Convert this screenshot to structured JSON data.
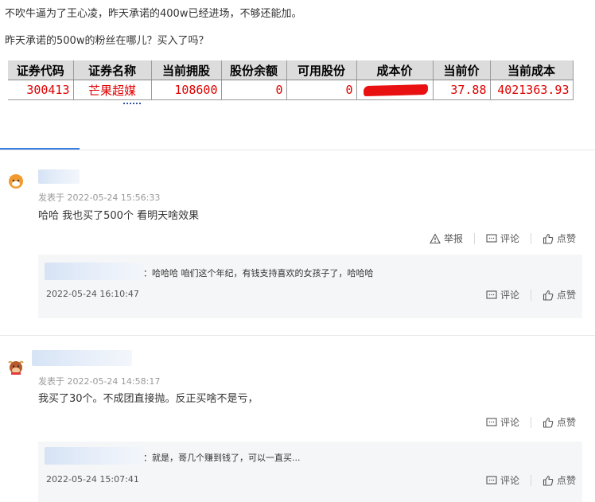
{
  "post": {
    "line1": "不吹牛逼为了王心凌，昨天承诺的400w已经进场，不够还能加。",
    "line2": "昨天承诺的500w的粉丝在哪儿？买入了吗？"
  },
  "stock_table": {
    "headers": [
      "证券代码",
      "证券名称",
      "当前拥股",
      "股份余额",
      "可用股份",
      "成本价",
      "当前价",
      "当前成本"
    ],
    "row": {
      "code": "300413",
      "name": "芒果超媒",
      "holding": "108600",
      "balance": "0",
      "available": "0",
      "current_price": "37.88",
      "current_cost": "4021363.93"
    }
  },
  "comments": [
    {
      "time": "发表于 2022-05-24 15:56:33",
      "text": "哈哈 我也买了500个 看明天啥效果",
      "actions": {
        "report": "举报",
        "comment": "评论",
        "like": "点赞"
      },
      "reply": {
        "text": "：哈哈哈 咱们这个年纪，有钱支持喜欢的女孩子了，哈哈哈",
        "time": "2022-05-24 16:10:47",
        "actions": {
          "comment": "评论",
          "like": "点赞"
        }
      }
    },
    {
      "time": "发表于 2022-05-24 14:58:17",
      "text": "我买了30个。不成团直接抛。反正买啥不是亏，",
      "actions": {
        "comment": "评论",
        "like": "点赞"
      },
      "reply": {
        "text": "：就是，哥几个赚到钱了，可以一直买...",
        "time": "2022-05-24 15:07:41",
        "actions": {
          "comment": "评论",
          "like": "点赞"
        }
      }
    }
  ],
  "colors": {
    "accent": "#3a7de0",
    "table_text": "#e00000",
    "redaction": "#e81010"
  }
}
